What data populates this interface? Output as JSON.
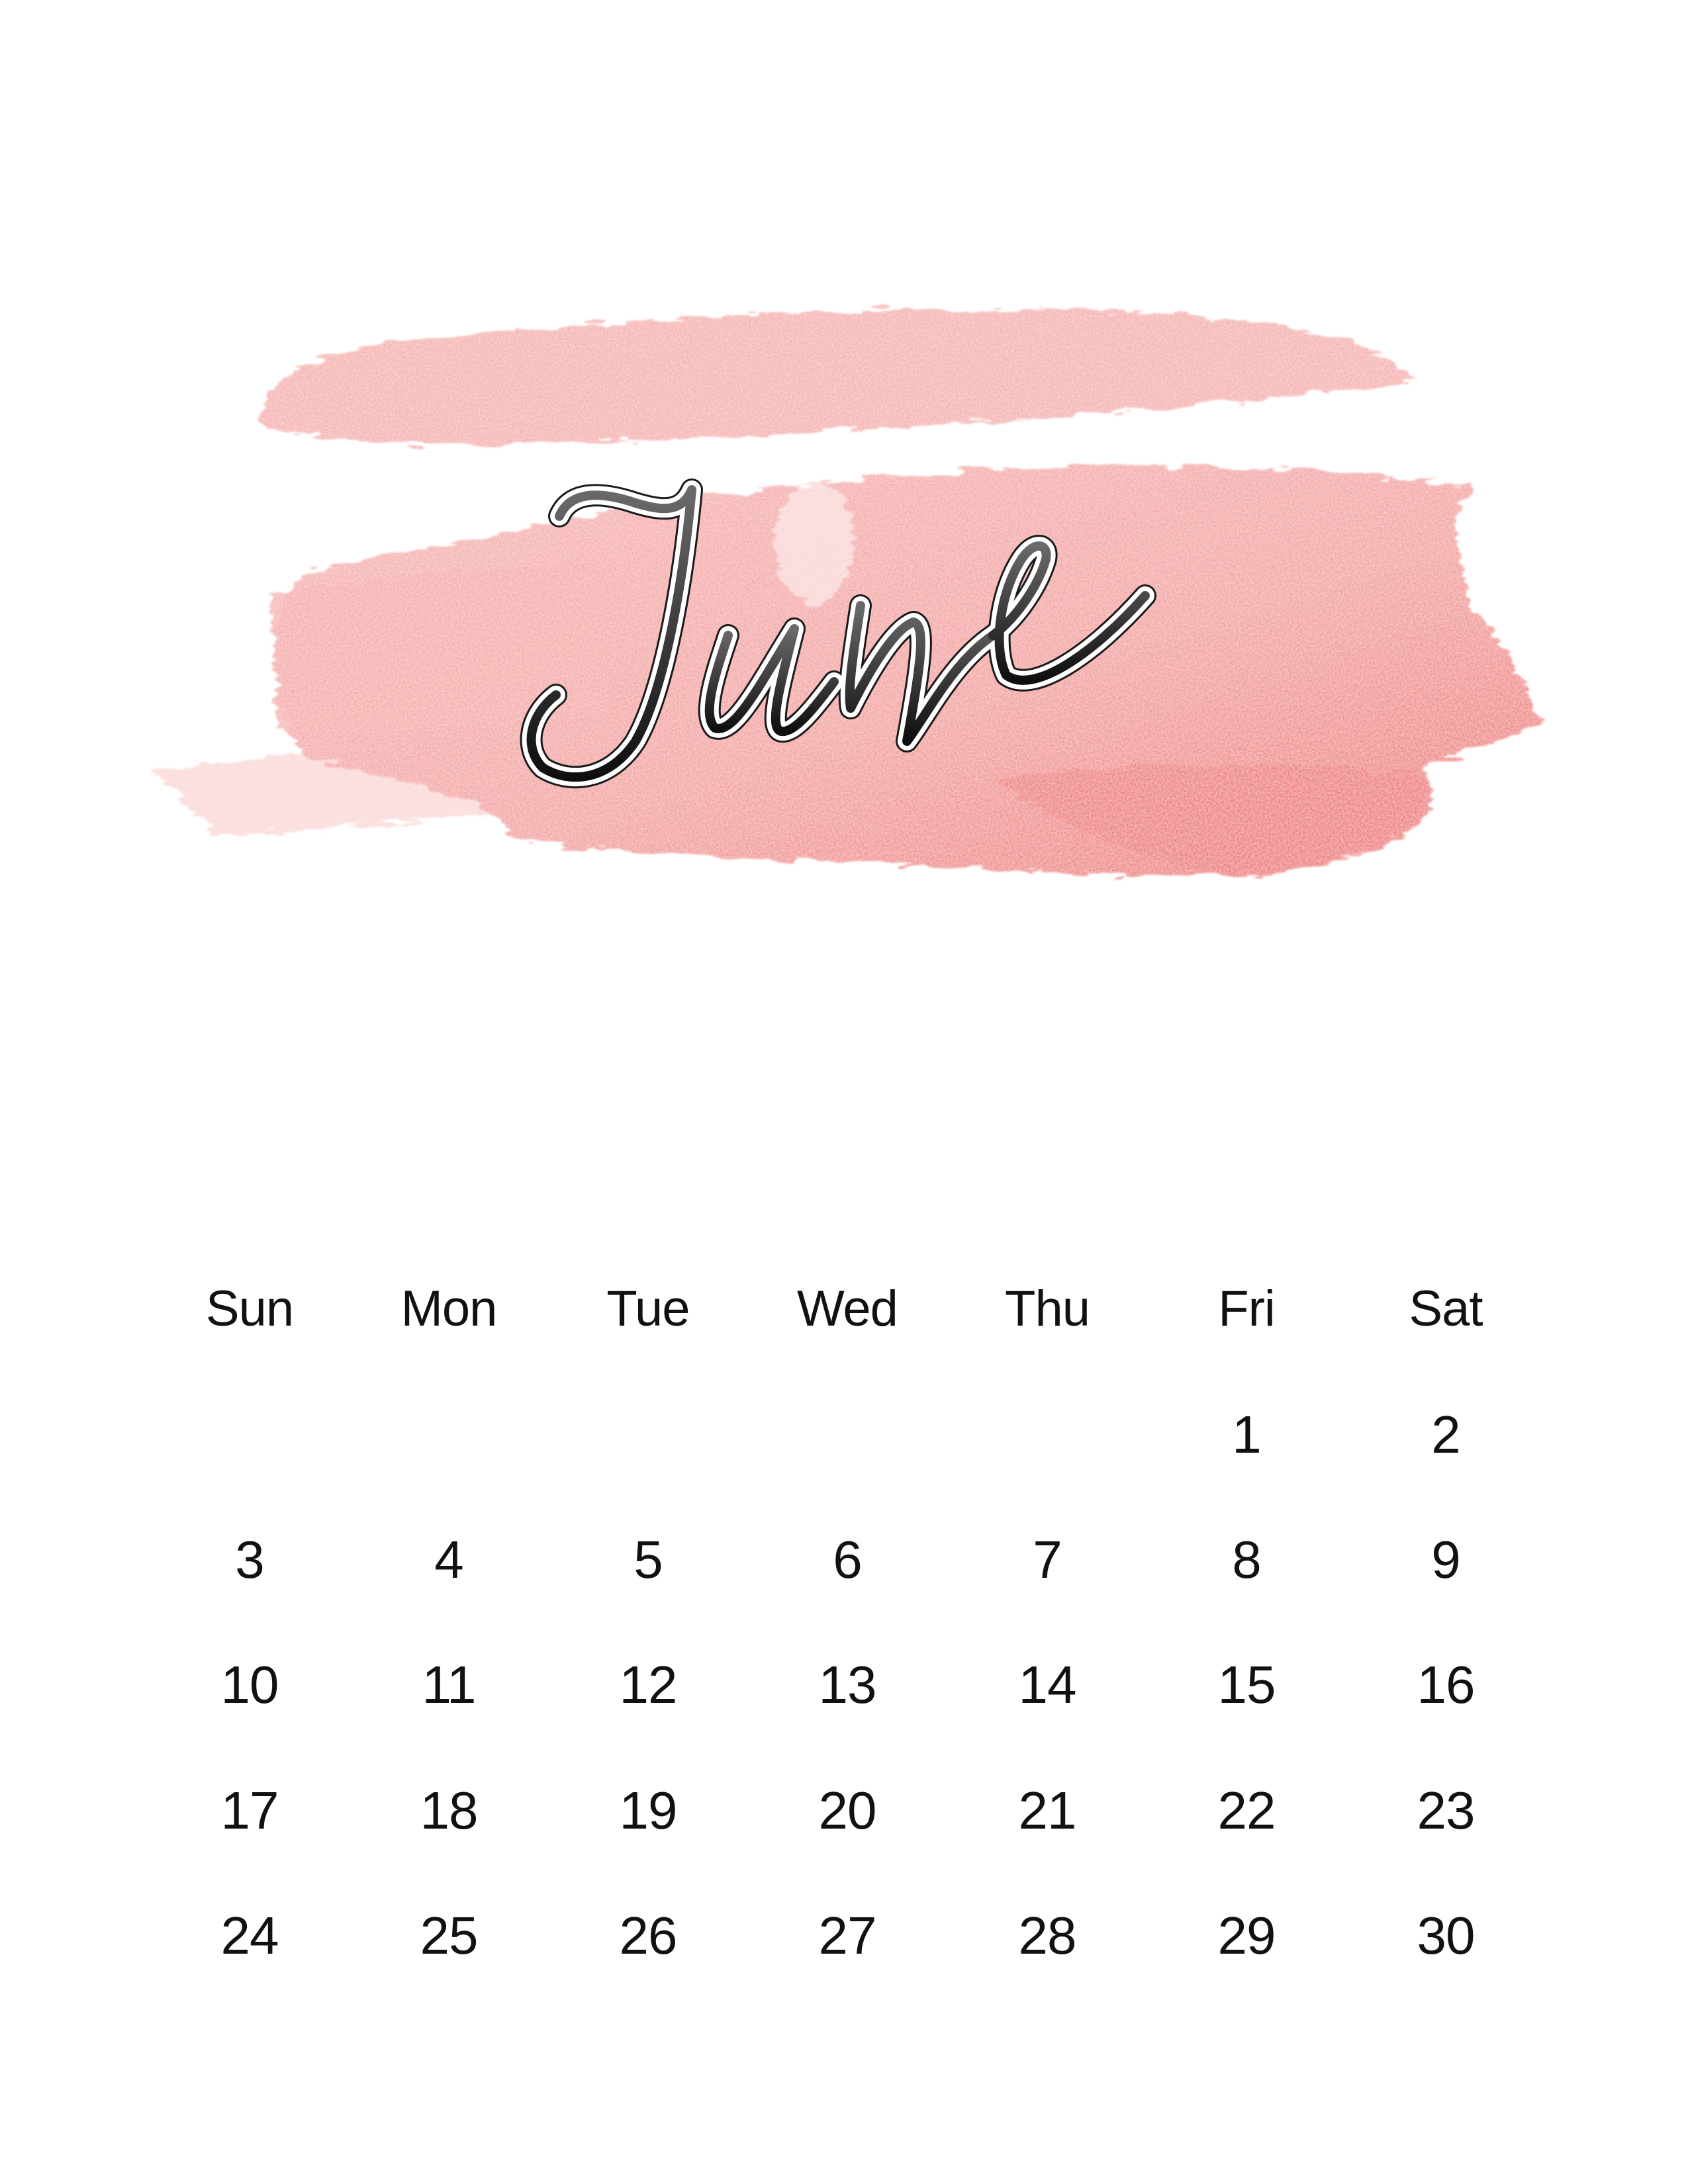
{
  "document": {
    "month": "June",
    "colors": {
      "watercolor_light": "#F8C4C2",
      "watercolor_mid": "#F3A6A4",
      "watercolor_dark": "#EE7A78",
      "script_top": "#5a5a5a",
      "script_bottom": "#111111",
      "text": "#111111"
    }
  },
  "calendar": {
    "weekdays": [
      "Sun",
      "Mon",
      "Tue",
      "Wed",
      "Thu",
      "Fri",
      "Sat"
    ],
    "weeks": [
      [
        "",
        "",
        "",
        "",
        "",
        "1",
        "2"
      ],
      [
        "3",
        "4",
        "5",
        "6",
        "7",
        "8",
        "9"
      ],
      [
        "10",
        "11",
        "12",
        "13",
        "14",
        "15",
        "16"
      ],
      [
        "17",
        "18",
        "19",
        "20",
        "21",
        "22",
        "23"
      ],
      [
        "24",
        "25",
        "26",
        "27",
        "28",
        "29",
        "30"
      ]
    ]
  }
}
